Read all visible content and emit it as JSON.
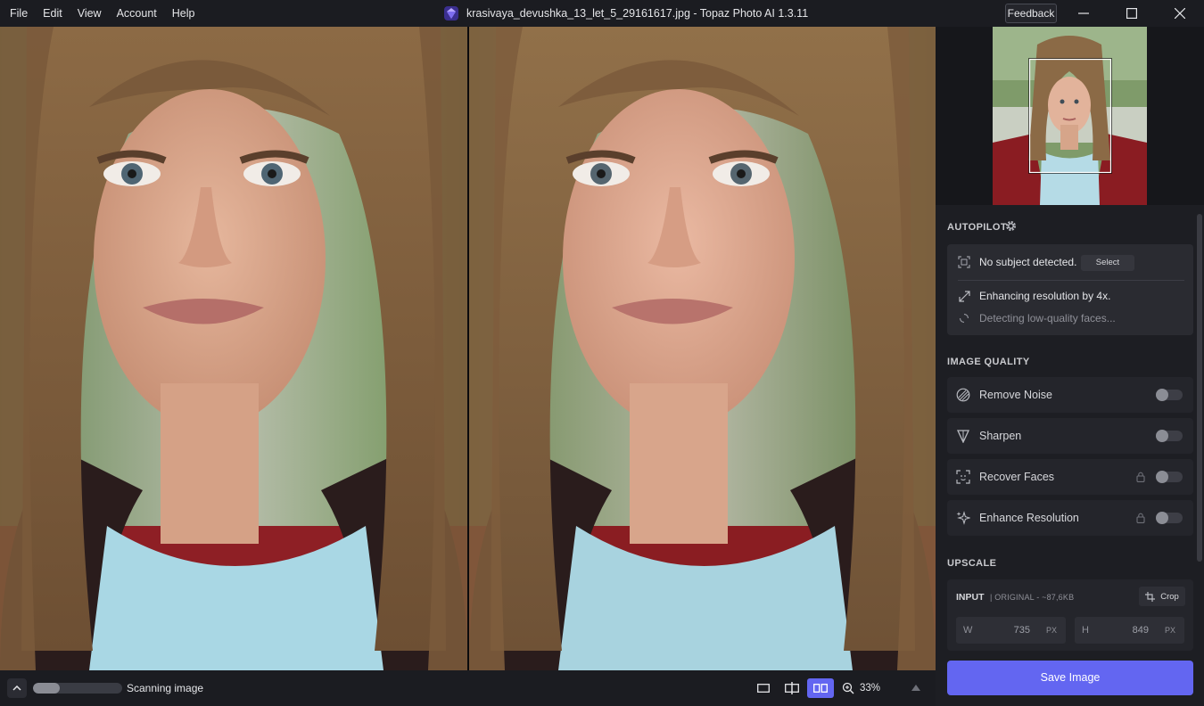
{
  "menu": [
    "File",
    "Edit",
    "View",
    "Account",
    "Help"
  ],
  "window": {
    "title": "krasivaya_devushka_13_let_5_29161617.jpg - Topaz Photo AI 1.3.11",
    "feedback_label": "Feedback"
  },
  "bottom_bar": {
    "status": "Scanning image",
    "progress_percent": 30,
    "zoom": "33%"
  },
  "autopilot": {
    "heading": "AUTOPILOT",
    "subject_text": "No subject detected.",
    "select_label": "Select",
    "resolution_text": "Enhancing resolution by 4x.",
    "faces_text": "Detecting low-quality faces..."
  },
  "image_quality": {
    "heading": "IMAGE QUALITY",
    "filters": [
      {
        "label": "Remove Noise",
        "icon": "noise-icon",
        "locked": false,
        "enabled": false
      },
      {
        "label": "Sharpen",
        "icon": "sharpen-icon",
        "locked": false,
        "enabled": false
      },
      {
        "label": "Recover Faces",
        "icon": "face-scan-icon",
        "locked": true,
        "enabled": false
      },
      {
        "label": "Enhance Resolution",
        "icon": "sparkle-icon",
        "locked": true,
        "enabled": false
      }
    ]
  },
  "upscale": {
    "heading": "UPSCALE",
    "input_label": "INPUT",
    "input_sub": "| ORIGINAL - ~87,6KB",
    "crop_label": "Crop",
    "width_key": "W",
    "width_value": "735",
    "height_key": "H",
    "height_value": "849",
    "unit": "PX"
  },
  "save_label": "Save Image",
  "colors": {
    "accent": "#6366f1",
    "panel": "#1d1e23",
    "titlebar": "#1b1c21"
  }
}
